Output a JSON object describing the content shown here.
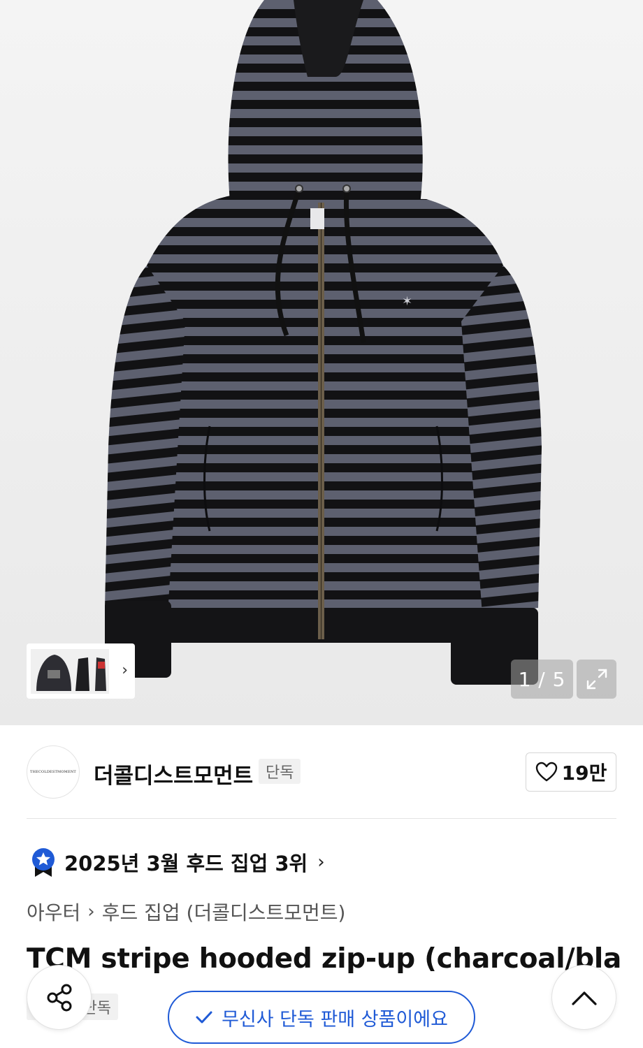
{
  "gallery": {
    "current": 1,
    "total": 5,
    "counter_text": "1 / 5"
  },
  "brand": {
    "name": "더콜디스트모먼트",
    "logo_text": "THECOLDESTMOMENT",
    "badge": "단독",
    "likes": "19만"
  },
  "ranking": {
    "text": "2025년 3월 후드 집업 3위"
  },
  "breadcrumb": {
    "category": "아우터",
    "subcategory": "후드 집업 (더콜디스트모먼트)"
  },
  "product": {
    "title": "TCM stripe hooded zip-up (charcoal/black)",
    "badge": "단독"
  },
  "notice": {
    "exclusive_label": "무신사 단독 판매 상품이에요"
  },
  "colors": {
    "accent": "#1f5ad6",
    "stripe_light": "#5c5f6e",
    "stripe_dark": "#111111"
  },
  "icons": {
    "share": "share-icon",
    "top": "chevron-up-icon",
    "like": "heart-icon",
    "expand": "expand-icon",
    "ranking": "ranking-badge-icon"
  }
}
